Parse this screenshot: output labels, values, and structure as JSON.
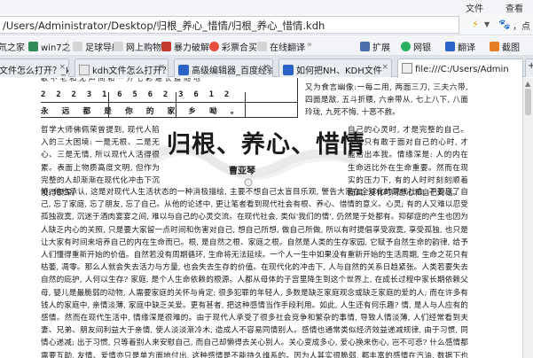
{
  "menu": {
    "file": "文件",
    "view": "查看"
  },
  "address": {
    "path": "/Users/Administrator/Desktop/归根_养心_惜情/归根_养心_惜情.kdh"
  },
  "bookmarks": [
    {
      "label": "氘之家",
      "color": "#3a7bd5"
    },
    {
      "label": "win7之",
      "color": "#2e8b57"
    },
    {
      "label": "足球导航",
      "color": "#d0d0d0"
    },
    {
      "label": "网上购物",
      "color": "#d0d0d0"
    },
    {
      "label": "暴力破解",
      "color": "#c0392b"
    },
    {
      "label": "彩票合买",
      "color": "#e74c3c"
    },
    {
      "label": "在线翻译",
      "color": "#d0d0d0"
    }
  ],
  "toolbar": {
    "ext": "扩展",
    "netbank": "网银",
    "translate": "翻译",
    "screenshot": "截图"
  },
  "tabs": [
    {
      "label": "文件怎么打开？_k"
    },
    {
      "label": "kdh文件怎么打开？kc"
    },
    {
      "label": "高级编辑器_百度经验"
    },
    {
      "label": "如何把NH、KDH文件"
    },
    {
      "label": "file:///C:/Users/Admin"
    }
  ],
  "doc": {
    "sheet_row1": "2 2 2 3 1 6 5  6 2 3 6 1   2",
    "sheet_row2": "永 远 都 是 你   的 家 乡 呦 。",
    "top_line": "歌 不 老  和 无 声  间 和 一 开  七 彩  遍  长 腰 随 地",
    "title": "归根、养心、惜情",
    "author": "曹亚琴",
    "right_top": "又为食言幽像:一每二用, 两面三刀, 三夫六带, 四面是敌, 五斗折腰, 六亲带从, 七上八下, 八面玲珑, 九死不悔, 十恶不赦。",
    "left_col": "哲学大师佛佩荣曾提到, 现代人陷入的三大困境: 一是无根、二是无心、三是无情, 所以现代人活得很累。表面上物质高度文明, 但作为完整的人却渐渐在现代化冲击下沉没得很深。",
    "right_col": "自己的心灵时, 才是完整的自己。人也只有敢于面对自己的心时, 才能活出本我。情缘深是: 人的内在生命远比外在生命重要。然而在现实的压力下, 有的人时时刻刻顺着面具, 没有时间静心和自己对话。",
    "body": "鲍, 他也承认, 这是对现代人生活状态的一种消极描绘, 主要不想自己太盲目乐观, 警告大家在全球化的现代社会, 不要忘了自己, 忘了家庭, 忘了朋友, 忘了自己。从他的论述中, 更让笔者看到现代社会有根、养心、惜情的意义。心灵; 有的人又难以忍受孤独寂寞, 沉迷于酒肉宴宴之间, 难以与自己的心灵交流。在现代社会, 类似'我们的情', 仍然是于处都有。抑郁症的产生也因为人缺乏内心的关照, 只是要大家留一点时间和伤害对自己, 想自己所想, 做自己所做, 所以有时提倡享受寂寞, 享受孤独, 也只是让大家有时间来培养自己的内在生命而已。根, 是自然之根、家庭之根。自然是人类的生存家园, 它赋予自然生命的韵律, 给予人们懂得重新开始的价值。自然若没有周期循环, 生命将无法延续。一个人一生中如果没有重新开始的生活周期, 生命之花只有枯萎, 凋零。那么人就会失去活力与方量, 也会失去生存的价值。在现代化的冲击下, 人与自然的关系日趋紧张。人类若要失去自然的庇护, 人何以生存? 家庭, 是个人生命依赖的根源。人都从母体的子宫里降生到这个世界上, 在成长过程中家长期依赖父母, 婴儿是最脆弱的动物, 人需要家庭的关怀与肯定; 很多犯罪的年轻人, 多数是缺乏家庭观念或缺乏家庭的爱的人; 而在许多有钱人的家庭中, 亲情淡薄, 家庭中缺乏关爱。更有甚者, 把这种感情当作手段利用。如此, 人生还有何乐趣? 情, 是人与人应有的感情。然而在现代生活中, 情缘深是很难的。由于现代人承受了很多社会竞争和繁杂的事情, 导致人情淡薄, 人们经常看到夫妻、兄弟、朋友间利益大于亲情, 使人淡淡渐冷木, 造成人不容易同情别人。感情也通常类似经济效益递减规律, 由于习惯, 同情心递减; 出于习惯, 只等着别人来安慰自己, 而自己却懒得去关心别人。关心变成多心, 爱心换来伤心, 岂不可悲? 什么感情都需要互助, 友情、爱情亦只是单方面地付出, 这种感情是不能持久维系的。因为人其实很脆弱, 都丰富的感情在汽油, 数据下也不能一世, 即使在前方也有哪一份美丽, 你们也要懂得珍视和"
  }
}
